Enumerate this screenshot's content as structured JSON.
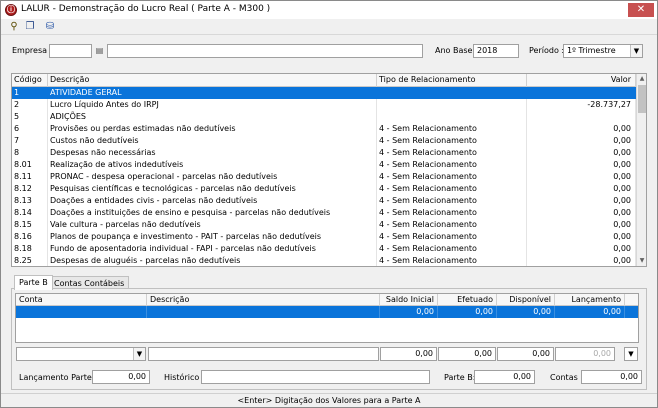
{
  "window": {
    "title": "LALUR - Demonstração do Lucro Real ( Parte A - M300 )",
    "close_glyph": "✕"
  },
  "toolbar": {
    "icons": [
      "search-icon",
      "copy-icon",
      "database-icon"
    ],
    "search_glyph": "⚲",
    "copy_glyph": "❐",
    "database_glyph": "⛁"
  },
  "filters": {
    "empresa_label": "Empresa :",
    "empresa_code": "",
    "empresa_name": "",
    "ano_base_label": "Ano Base :",
    "ano_base_value": "2018",
    "periodo_label": "Período :",
    "periodo_value": "1º Trimestre",
    "dropdown_glyph": "▼"
  },
  "main_table": {
    "columns": [
      "Código",
      "Descrição",
      "Tipo de Relacionamento",
      "Valor"
    ],
    "rows": [
      {
        "codigo": "1",
        "descricao": "ATIVIDADE GERAL",
        "tipo": "",
        "valor": ""
      },
      {
        "codigo": "2",
        "descricao": "Lucro Líquido Antes do IRPJ",
        "tipo": "",
        "valor": "-28.737,27"
      },
      {
        "codigo": "5",
        "descricao": "ADIÇÕES",
        "tipo": "",
        "valor": ""
      },
      {
        "codigo": "6",
        "descricao": "Provisões ou perdas estimadas não dedutíveis",
        "tipo": "4 - Sem Relacionamento",
        "valor": "0,00"
      },
      {
        "codigo": "7",
        "descricao": "Custos não dedutíveis",
        "tipo": "4 - Sem Relacionamento",
        "valor": "0,00"
      },
      {
        "codigo": "8",
        "descricao": "Despesas não necessárias",
        "tipo": "4 - Sem Relacionamento",
        "valor": "0,00"
      },
      {
        "codigo": "8.01",
        "descricao": "Realização de ativos indedutíveis",
        "tipo": "4 - Sem Relacionamento",
        "valor": "0,00"
      },
      {
        "codigo": "8.11",
        "descricao": "PRONAC - despesa operacional - parcelas não dedutíveis",
        "tipo": "4 - Sem Relacionamento",
        "valor": "0,00"
      },
      {
        "codigo": "8.12",
        "descricao": "Pesquisas científicas e tecnológicas - parcelas não dedutíveis",
        "tipo": "4 - Sem Relacionamento",
        "valor": "0,00"
      },
      {
        "codigo": "8.13",
        "descricao": "Doações a entidades civis - parcelas não dedutíveis",
        "tipo": "4 - Sem Relacionamento",
        "valor": "0,00"
      },
      {
        "codigo": "8.14",
        "descricao": "Doações a instituições de ensino e pesquisa - parcelas não dedutíveis",
        "tipo": "4 - Sem Relacionamento",
        "valor": "0,00"
      },
      {
        "codigo": "8.15",
        "descricao": "Vale cultura - parcelas não dedutíveis",
        "tipo": "4 - Sem Relacionamento",
        "valor": "0,00"
      },
      {
        "codigo": "8.16",
        "descricao": "Planos de poupança e investimento - PAIT - parcelas não dedutíveis",
        "tipo": "4 - Sem Relacionamento",
        "valor": "0,00"
      },
      {
        "codigo": "8.18",
        "descricao": "Fundo de aposentadoria individual - FAPI - parcelas não dedutíveis",
        "tipo": "4 - Sem Relacionamento",
        "valor": "0,00"
      },
      {
        "codigo": "8.25",
        "descricao": "Despesas de aluguéis - parcelas não dedutíveis",
        "tipo": "4 - Sem Relacionamento",
        "valor": "0,00"
      }
    ],
    "scroll_up_glyph": "▲",
    "scroll_down_glyph": "▼"
  },
  "tabs": [
    {
      "label": "Parte B"
    },
    {
      "label": "Contas Contábeis"
    }
  ],
  "sub_table": {
    "columns": [
      "Conta",
      "Descrição",
      "Saldo Inicial",
      "Efetuado",
      "Disponível",
      "Lançamento"
    ],
    "row": {
      "saldo_inicial": "0,00",
      "efetuado": "0,00",
      "disponivel": "0,00",
      "lancamento": "0,00"
    }
  },
  "edit_row": {
    "conta": "",
    "descricao": "",
    "saldo_inicial": "0,00",
    "efetuado": "0,00",
    "disponivel": "0,00",
    "lancamento": "0,00",
    "dropdown_glyph": "▼"
  },
  "footer": {
    "lancamento_parte_a_label": "Lançamento Parte A:",
    "lancamento_parte_a_value": "0,00",
    "historico_label": "Histórico :",
    "historico_value": "",
    "parte_b_label": "Parte B:",
    "parte_b_value": "0,00",
    "contas_label": "Contas :",
    "contas_value": "0,00"
  },
  "status_bar": {
    "text": "<Enter> Digitação dos Valores para a Parte A"
  }
}
